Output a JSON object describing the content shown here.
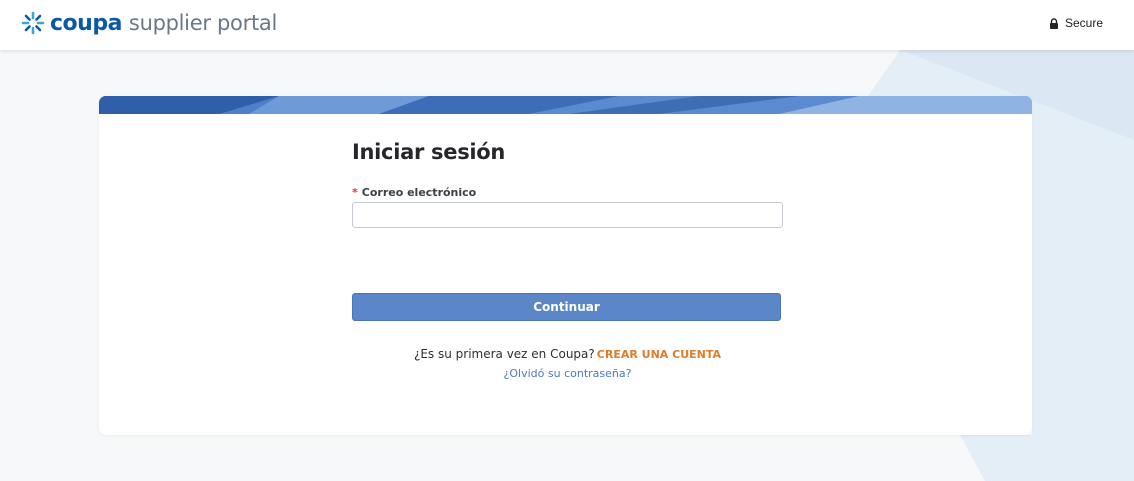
{
  "header": {
    "brand": "coupa",
    "product": "supplier portal",
    "secure_label": "Secure"
  },
  "form": {
    "title": "Iniciar sesión",
    "required_marker": "*",
    "email_label": "Correo electrónico",
    "email_value": "",
    "email_placeholder": "",
    "continue_label": "Continuar",
    "first_time_text": "¿Es su primera vez en Coupa?",
    "create_account_label": "CREAR UNA CUENTA",
    "forgot_password_label": "¿Olvidó su contraseña?"
  },
  "icons": {
    "logo": "coupa-logo-icon",
    "secure": "lock-icon"
  },
  "colors": {
    "brand_blue": "#0a5aa8",
    "button_blue": "#5b86c7",
    "link_orange": "#e07b2a",
    "link_blue": "#4a79c2",
    "required_red": "#d93a3a"
  }
}
